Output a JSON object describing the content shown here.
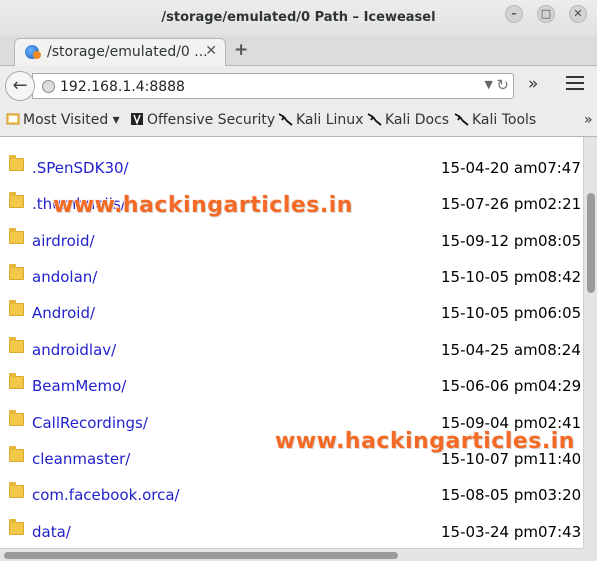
{
  "window": {
    "title": "/storage/emulated/0 Path – Iceweasel",
    "buttons": {
      "minimize": "–",
      "maximize": "□",
      "close": "✕"
    }
  },
  "tab": {
    "title": "/storage/emulated/0 ...",
    "close": "✕",
    "new_tab": "+"
  },
  "navbar": {
    "url": "192.168.1.4:8888",
    "back_icon": "←",
    "dropdown_icon": "▼",
    "reload_icon": "↻",
    "overflow_icon": "»"
  },
  "bookmarks": {
    "items": [
      {
        "label": "Most Visited ▾",
        "icon": "most-visited-icon"
      },
      {
        "label": "Offensive Security",
        "icon": "offensive-security-icon"
      },
      {
        "label": "Kali Linux",
        "icon": "kali-dragon-icon"
      },
      {
        "label": "Kali Docs",
        "icon": "kali-dragon-icon"
      },
      {
        "label": "Kali Tools",
        "icon": "kali-dragon-icon"
      }
    ],
    "chevron": "»"
  },
  "listing": {
    "rows": [
      {
        "name": ".SPenSDK30/",
        "date": "15-04-20 am07:47"
      },
      {
        "name": ".thumbnails/",
        "date": "15-07-26 pm02:21"
      },
      {
        "name": "airdroid/",
        "date": "15-09-12 pm08:05"
      },
      {
        "name": "andolan/",
        "date": "15-10-05 pm08:42"
      },
      {
        "name": "Android/",
        "date": "15-10-05 pm06:05"
      },
      {
        "name": "androidlav/",
        "date": "15-04-25 am08:24"
      },
      {
        "name": "BeamMemo/",
        "date": "15-06-06 pm04:29"
      },
      {
        "name": "CallRecordings/",
        "date": "15-09-04 pm02:41"
      },
      {
        "name": "cleanmaster/",
        "date": "15-10-07 pm11:40"
      },
      {
        "name": "com.facebook.orca/",
        "date": "15-08-05 pm03:20"
      },
      {
        "name": "data/",
        "date": "15-03-24 pm07:43"
      }
    ]
  },
  "watermarks": [
    "www.hackingarticles.in",
    "www.hackingarticles.in"
  ],
  "colors": {
    "link": "#2222cc",
    "watermark": "#f26a26",
    "folder": "#f2c84b"
  }
}
